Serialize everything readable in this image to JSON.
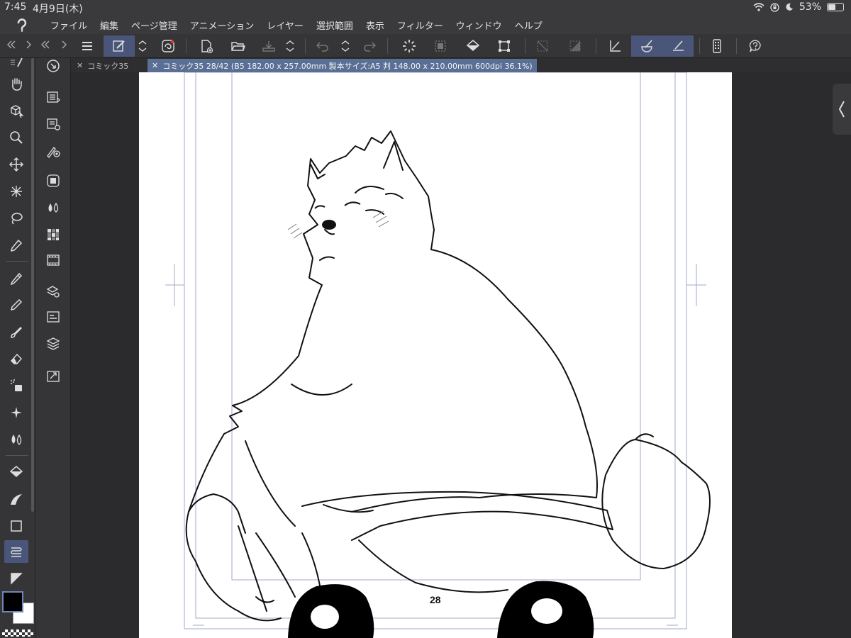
{
  "status": {
    "time": "7:45",
    "date": "4月9日(木)",
    "battery": "53%",
    "battery_level": 0.53
  },
  "menu": [
    "ファイル",
    "編集",
    "ページ管理",
    "アニメーション",
    "レイヤー",
    "選択範囲",
    "表示",
    "フィルター",
    "ウィンドウ",
    "ヘルプ"
  ],
  "tabs": {
    "inactive": "コミック35",
    "active": "コミック35 28/42 (B5 182.00 x 257.00mm 製本サイズ:A5 判 148.00 x 210.00mm 600dpi 36.1%)"
  },
  "canvas": {
    "page_number": "28"
  },
  "icons": {
    "menu": "hamburger-icon",
    "collapse": "chevron-left-icon"
  },
  "colors": {
    "accent": "#4a5679",
    "tab_active": "#5a6f95",
    "main_color": "#000000",
    "sub_color": "#ffffff"
  }
}
